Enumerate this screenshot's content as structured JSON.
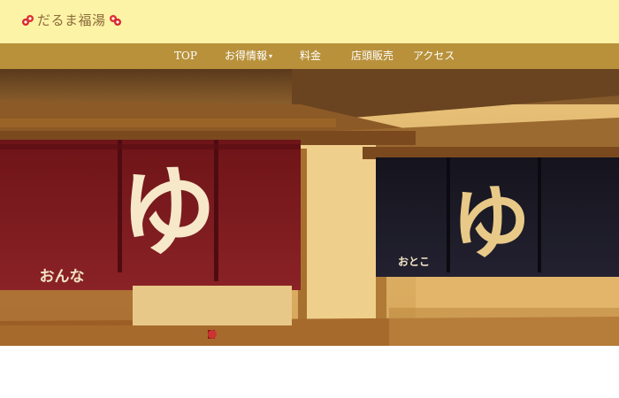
{
  "site": {
    "title": "だるま福湯"
  },
  "nav": {
    "items": [
      {
        "label": "TOP",
        "has_dropdown": false
      },
      {
        "label": "お得情報",
        "has_dropdown": true
      },
      {
        "label": "料金",
        "has_dropdown": false
      },
      {
        "label": "店頭販売",
        "has_dropdown": false
      },
      {
        "label": "アクセス",
        "has_dropdown": false
      }
    ]
  },
  "hero": {
    "women_noren_text": "おんな",
    "men_noren_text": "おとこ",
    "noren_symbol": "ゆ"
  },
  "colors": {
    "header_bg": "#fdf3a6",
    "nav_bg": "#b8913a",
    "women_noren": "#7e1a1e",
    "men_noren": "#1c1a26"
  }
}
